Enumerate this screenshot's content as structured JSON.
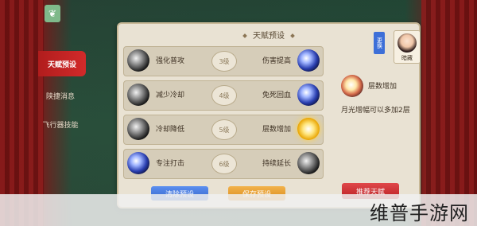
{
  "nav": {
    "back_icon": "leaf-icon",
    "items": [
      {
        "label": "天赋预设",
        "active": true
      },
      {
        "label": "陕捷消息",
        "active": false
      },
      {
        "label": "飞行器技能",
        "active": false
      }
    ]
  },
  "panel": {
    "title": "天赋预设",
    "rows": [
      {
        "left_name": "强化普攻",
        "left_icon": "dark-orb-icon",
        "level": "3级",
        "right_name": "伤害提高",
        "right_icon": "blue-orb-icon"
      },
      {
        "left_name": "减少冷却",
        "left_icon": "dark-orb-icon",
        "level": "4级",
        "right_name": "免死回血",
        "right_icon": "blue-orb-icon"
      },
      {
        "left_name": "冷却降低",
        "left_icon": "dark-orb-icon",
        "level": "5级",
        "right_name": "层数增加",
        "right_icon": "gold-orb-icon"
      },
      {
        "left_name": "专注打击",
        "left_icon": "blue-orb-icon",
        "level": "6级",
        "right_name": "持续延长",
        "right_icon": "dark-orb-icon"
      }
    ]
  },
  "detail": {
    "name": "层数增加",
    "description": "月光增幅可以多加2层"
  },
  "character": {
    "switch_label": "更换",
    "name": "暗藏"
  },
  "buttons": {
    "reset": "清除预设",
    "save": "保存预设",
    "recommend": "推荐天赋"
  },
  "watermark": "维普手游网"
}
